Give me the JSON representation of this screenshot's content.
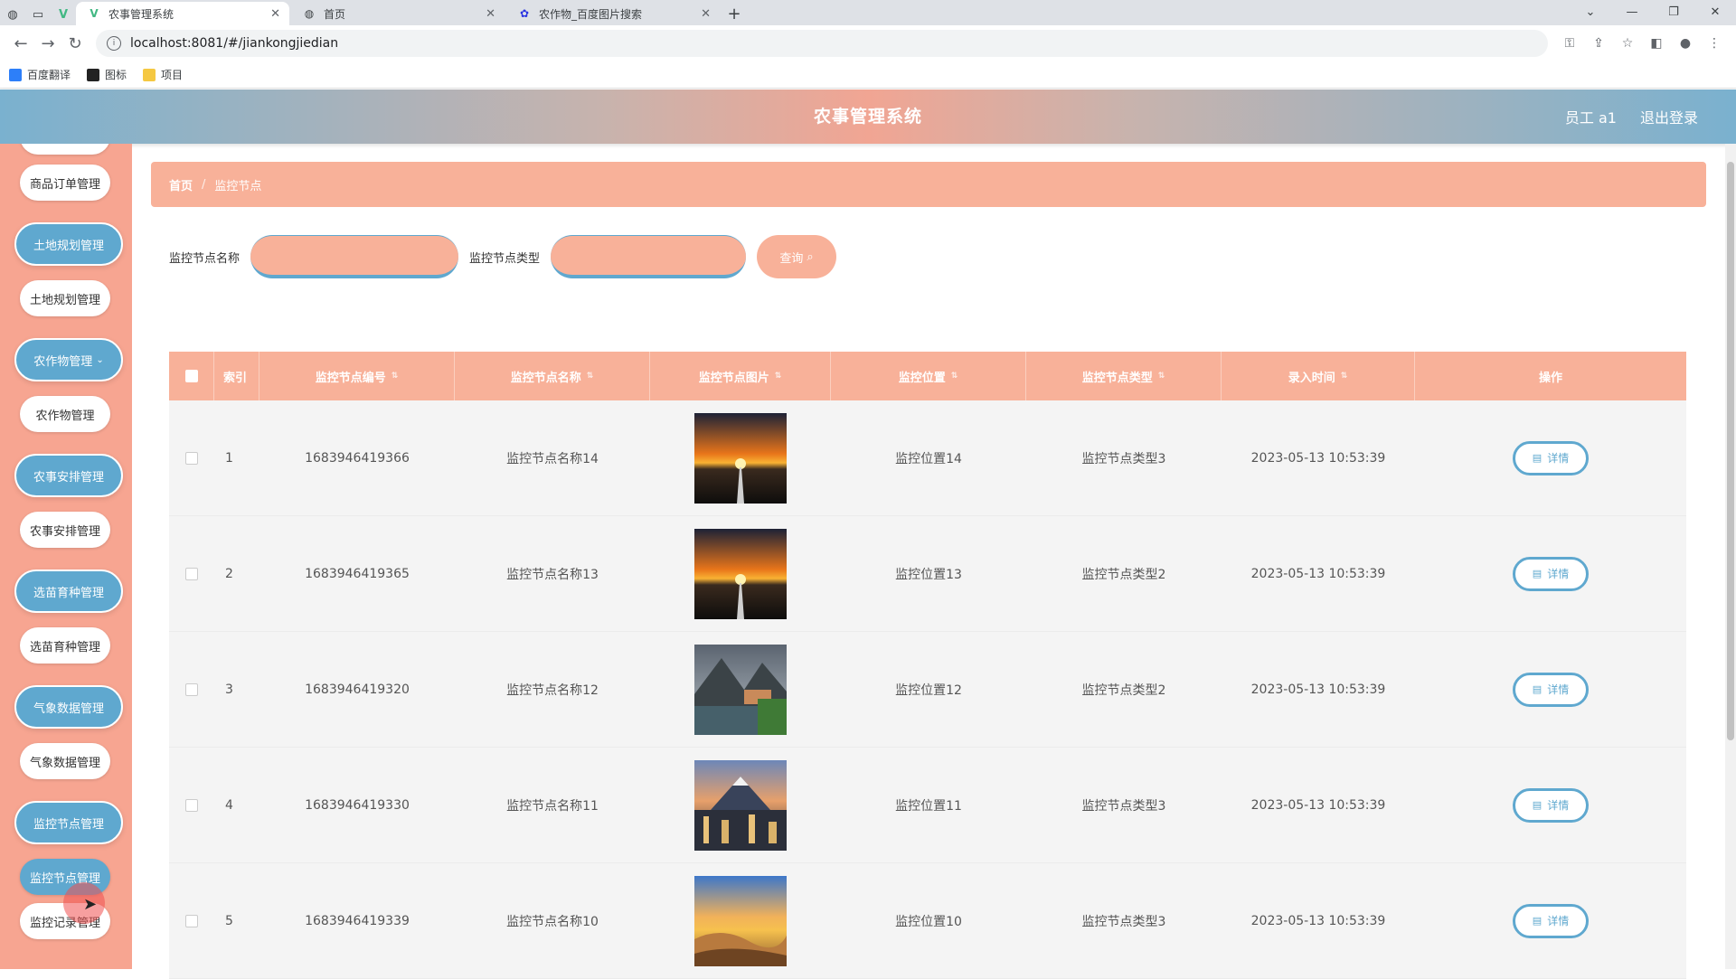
{
  "browser": {
    "tabs": [
      {
        "title": "农事管理系统",
        "active": true
      },
      {
        "title": "首页",
        "active": false
      },
      {
        "title": "农作物_百度图片搜索",
        "active": false
      }
    ],
    "url": "localhost:8081/#/jiankongjiedian",
    "bookmarks": [
      "百度翻译",
      "图标",
      "项目"
    ]
  },
  "header": {
    "title": "农事管理系统",
    "user": "员工 a1",
    "logout": "退出登录"
  },
  "sidebar": {
    "items": [
      {
        "label": "商品订单管理",
        "kind": "item"
      },
      {
        "label": "土地规划管理",
        "kind": "group"
      },
      {
        "label": "土地规划管理",
        "kind": "item"
      },
      {
        "label": "农作物管理",
        "kind": "group"
      },
      {
        "label": "农作物管理",
        "kind": "item"
      },
      {
        "label": "农事安排管理",
        "kind": "group"
      },
      {
        "label": "农事安排管理",
        "kind": "item"
      },
      {
        "label": "选苗育种管理",
        "kind": "group"
      },
      {
        "label": "选苗育种管理",
        "kind": "item"
      },
      {
        "label": "气象数据管理",
        "kind": "group"
      },
      {
        "label": "气象数据管理",
        "kind": "item"
      },
      {
        "label": "监控节点管理",
        "kind": "group"
      },
      {
        "label": "监控节点管理",
        "kind": "item"
      },
      {
        "label": "监控记录管理",
        "kind": "item"
      }
    ]
  },
  "breadcrumb": {
    "home": "首页",
    "current": "监控节点"
  },
  "search": {
    "name_label": "监控节点名称",
    "type_label": "监控节点类型",
    "query_label": "查询"
  },
  "table": {
    "headers": [
      "索引",
      "监控节点编号",
      "监控节点名称",
      "监控节点图片",
      "监控位置",
      "监控节点类型",
      "录入时间",
      "操作"
    ],
    "detail_label": "详情",
    "rows": [
      {
        "index": "1",
        "code": "1683946419366",
        "name": "监控节点名称14",
        "location": "监控位置14",
        "type": "监控节点类型3",
        "time": "2023-05-13 10:53:39",
        "image": "sunset-road"
      },
      {
        "index": "2",
        "code": "1683946419365",
        "name": "监控节点名称13",
        "location": "监控位置13",
        "type": "监控节点类型2",
        "time": "2023-05-13 10:53:39",
        "image": "sunset-road"
      },
      {
        "index": "3",
        "code": "1683946419320",
        "name": "监控节点名称12",
        "location": "监控位置12",
        "type": "监控节点类型2",
        "time": "2023-05-13 10:53:39",
        "image": "lake-village"
      },
      {
        "index": "4",
        "code": "1683946419330",
        "name": "监控节点名称11",
        "location": "监控位置11",
        "type": "监控节点类型3",
        "time": "2023-05-13 10:53:39",
        "image": "mountain-city"
      },
      {
        "index": "5",
        "code": "1683946419339",
        "name": "监控节点名称10",
        "location": "监控位置10",
        "type": "监控节点类型3",
        "time": "2023-05-13 10:53:39",
        "image": "desert-sunset"
      }
    ]
  },
  "colors": {
    "accent_blue": "#5fa8cf",
    "accent_salmon": "#f8b199"
  }
}
